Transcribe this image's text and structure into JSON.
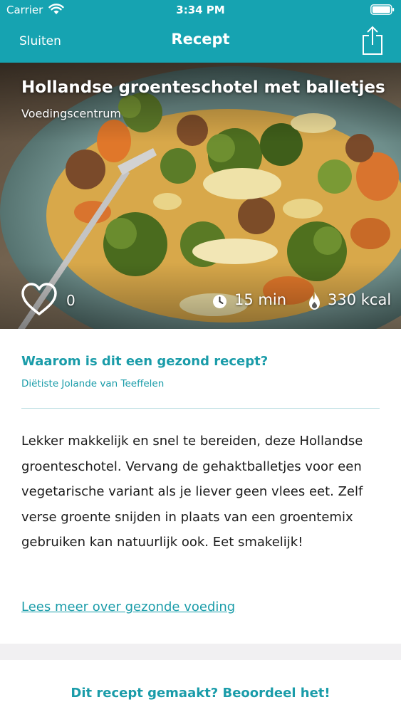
{
  "status_bar": {
    "carrier": "Carrier",
    "time": "3:34 PM"
  },
  "nav": {
    "close_label": "Sluiten",
    "title": "Recept",
    "share_icon": "share-icon"
  },
  "recipe": {
    "title": "Hollandse groenteschotel met balletjes",
    "source": "Voedingscentrum",
    "likes": "0",
    "prep_time": "15 min",
    "calories": "330 kcal"
  },
  "health": {
    "heading": "Waarom is dit een gezond recept?",
    "author": "Diëtiste Jolande van Teeffelen",
    "text": "Lekker makkelijk en snel te bereiden, deze Hollandse groenteschotel. Vervang de gehaktballetjes voor een vegetarische variant als je liever geen vlees eet. Zelf verse groente snijden in plaats van een groentemix gebruiken kan natuurlijk ook. Eet smakelijk!",
    "link": "Lees meer over gezonde voeding"
  },
  "footer": {
    "rate_label": "Dit recept gemaakt? Beoordeel het!"
  },
  "colors": {
    "accent": "#16a3b1",
    "link": "#1a9ca9",
    "separator": "#f1f0f2"
  }
}
